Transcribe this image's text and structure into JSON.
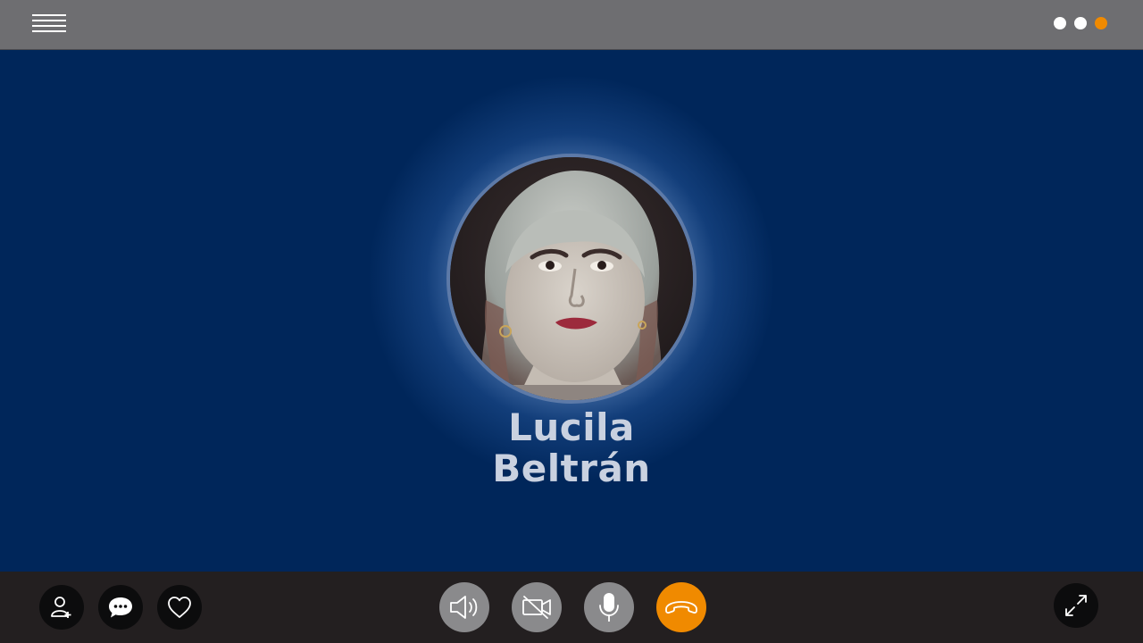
{
  "topbar": {
    "menu_icon": "hamburger-menu-icon",
    "pager": {
      "count": 3,
      "active_index": 2,
      "active_color": "#f08a00",
      "inactive_color": "#ffffff"
    }
  },
  "call": {
    "caller_first_name": "Lucila",
    "caller_last_name": "Beltrán",
    "background_color": "#00265a",
    "name_color": "#c9d1e0"
  },
  "controls": {
    "left": [
      {
        "name": "add-contact-button",
        "icon": "add-person-icon"
      },
      {
        "name": "chat-button",
        "icon": "chat-bubble-icon"
      },
      {
        "name": "favorite-button",
        "icon": "heart-icon"
      }
    ],
    "center": [
      {
        "name": "speaker-button",
        "icon": "speaker-icon"
      },
      {
        "name": "video-toggle-button",
        "icon": "video-off-icon"
      },
      {
        "name": "microphone-button",
        "icon": "microphone-icon"
      },
      {
        "name": "end-call-button",
        "icon": "hang-up-icon",
        "color": "#f08a00"
      }
    ],
    "right": [
      {
        "name": "fullscreen-button",
        "icon": "expand-icon"
      }
    ]
  }
}
